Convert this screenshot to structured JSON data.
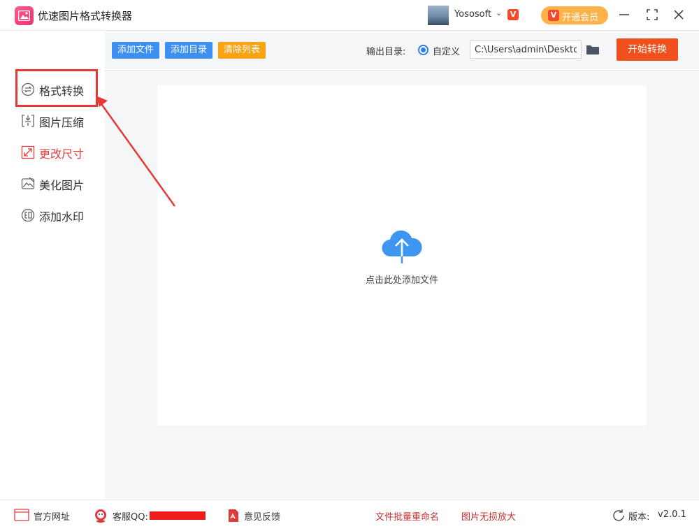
{
  "app": {
    "title": "优速图片格式转换器"
  },
  "user": {
    "name": "Yososoft",
    "vip_badge": "V",
    "vip_button_label": "开通会员"
  },
  "sidebar": {
    "items": [
      {
        "label": "格式转换",
        "icon": "format-convert-icon"
      },
      {
        "label": "图片压缩",
        "icon": "compress-icon"
      },
      {
        "label": "更改尺寸",
        "icon": "resize-icon"
      },
      {
        "label": "美化图片",
        "icon": "beautify-icon"
      },
      {
        "label": "添加水印",
        "icon": "watermark-icon"
      }
    ]
  },
  "toolbar": {
    "add_file": "添加文件",
    "add_dir": "添加目录",
    "clear_list": "清除列表",
    "output_label": "输出目录:",
    "radio_label": "自定义",
    "output_path": "C:\\Users\\admin\\Deskto",
    "start_button": "开始转换"
  },
  "main": {
    "drop_text": "点击此处添加文件"
  },
  "footer": {
    "website": "官方网址",
    "qq": "客服QQ:",
    "feedback": "意见反馈",
    "batch_rename": "文件批量重命名",
    "lossless_zoom": "图片无损放大",
    "version_label": "版本:",
    "version": "v2.0.1"
  },
  "colors": {
    "accent_blue": "#3d8ff0",
    "accent_orange": "#f8a313",
    "start_red": "#f0501c",
    "highlight_red": "#e53935"
  }
}
